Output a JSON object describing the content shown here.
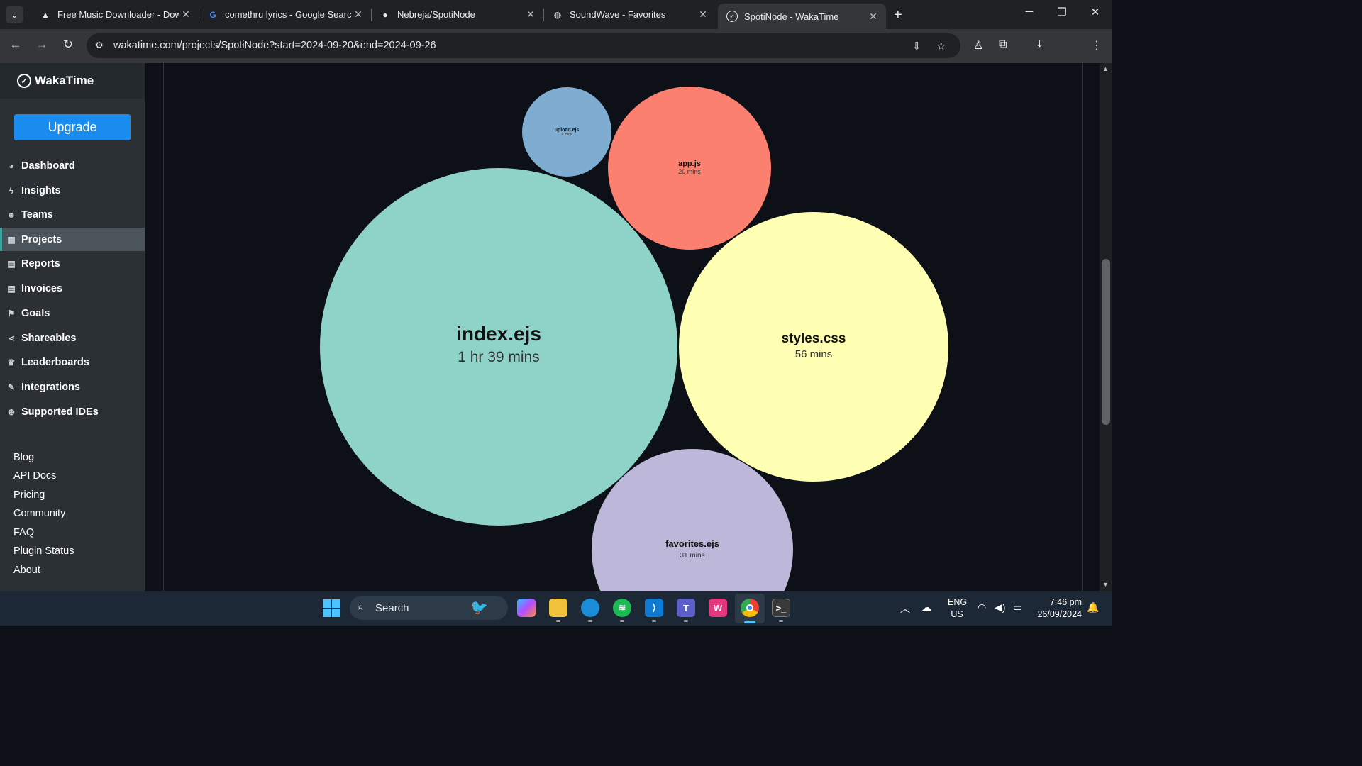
{
  "browser": {
    "tabs": [
      {
        "title": "Free Music Downloader - Down",
        "icon": "triangle-icon"
      },
      {
        "title": "comethru lyrics - Google Search",
        "icon": "google-icon"
      },
      {
        "title": "Nebreja/SpotiNode",
        "icon": "github-icon"
      },
      {
        "title": "SoundWave - Favorites",
        "icon": "globe-icon"
      },
      {
        "title": "SpotiNode - WakaTime",
        "icon": "wakatime-icon",
        "active": true
      }
    ],
    "url": "wakatime.com/projects/SpotiNode?start=2024-09-20&end=2024-09-26"
  },
  "sidebar": {
    "brand": "WakaTime",
    "upgrade_label": "Upgrade",
    "nav": [
      {
        "label": "Dashboard",
        "icon": "dashboard-icon"
      },
      {
        "label": "Insights",
        "icon": "bolt-icon"
      },
      {
        "label": "Teams",
        "icon": "users-icon"
      },
      {
        "label": "Projects",
        "icon": "grid-icon",
        "active": true
      },
      {
        "label": "Reports",
        "icon": "pdf-icon"
      },
      {
        "label": "Invoices",
        "icon": "file-icon"
      },
      {
        "label": "Goals",
        "icon": "flag-icon"
      },
      {
        "label": "Shareables",
        "icon": "share-icon"
      },
      {
        "label": "Leaderboards",
        "icon": "trophy-icon"
      },
      {
        "label": "Integrations",
        "icon": "wrench-icon"
      },
      {
        "label": "Supported IDEs",
        "icon": "plus-circle-icon"
      }
    ],
    "footer_links": [
      "Blog",
      "API Docs",
      "Pricing",
      "Community",
      "FAQ",
      "Plugin Status",
      "About"
    ]
  },
  "files": [
    {
      "name": "index.ejs",
      "time": "1 hr 39 mins",
      "minutes": 99,
      "color": "#8fd3c8"
    },
    {
      "name": "styles.css",
      "time": "56 mins",
      "minutes": 56,
      "color": "#ffffb4"
    },
    {
      "name": "favorites.ejs",
      "time": "31 mins",
      "minutes": 31,
      "color": "#bdb8d9"
    },
    {
      "name": "app.js",
      "time": "20 mins",
      "minutes": 20,
      "color": "#fc8070"
    },
    {
      "name": "upload.ejs",
      "time": "6 mins",
      "minutes": 6,
      "color": "#7fadd2"
    }
  ],
  "taskbar": {
    "search_placeholder": "Search",
    "lang_line1": "ENG",
    "lang_line2": "US",
    "time": "7:46 pm",
    "date": "26/09/2024"
  }
}
